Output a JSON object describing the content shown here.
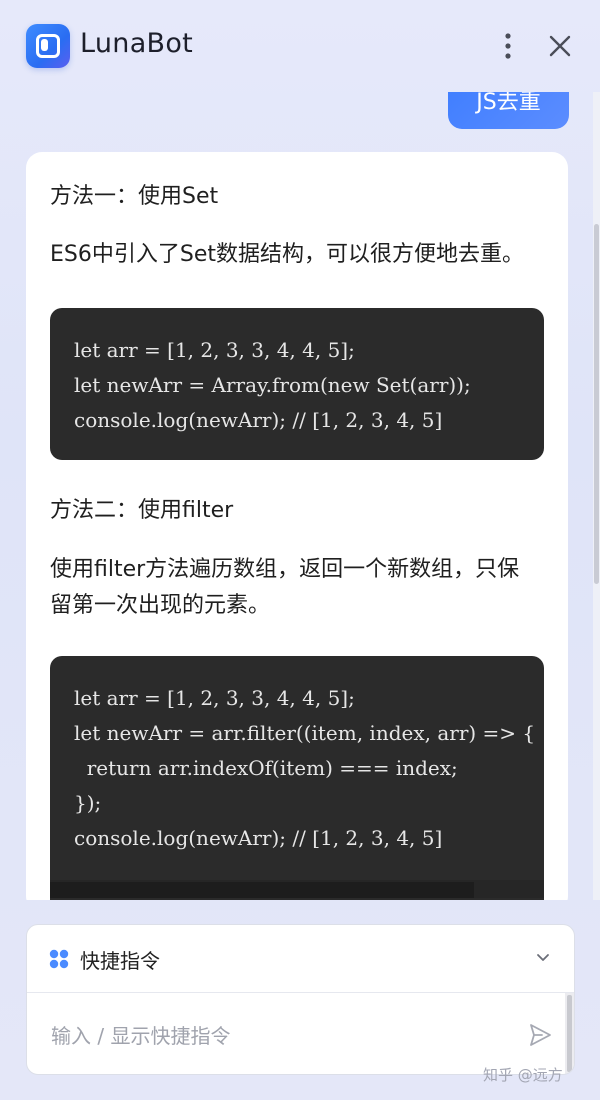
{
  "app": {
    "title": "LunaBot",
    "icons": {
      "logo": "lunabot-logo",
      "more": "more-vertical-icon",
      "close": "close-icon"
    },
    "colors": {
      "accent": "#3d7dff",
      "code_bg": "#2b2b2b"
    }
  },
  "chat": {
    "user_message": "JS去重",
    "bot_reply": {
      "method1_title": "方法一：使用Set",
      "method1_desc": "ES6中引入了Set数据结构，可以很方便地去重。",
      "code1": [
        "let arr = [1, 2, 3, 3, 4, 4, 5];",
        "let newArr = Array.from(new Set(arr));",
        "console.log(newArr); // [1, 2, 3, 4, 5]"
      ],
      "method2_title": "方法二：使用filter",
      "method2_desc_line1": "使用filter方法遍历数组，返回一个新数组，只保",
      "method2_desc_line2": "留第一次出现的元素。",
      "code2": [
        "let arr = [1, 2, 3, 3, 4, 4, 5];",
        "let newArr = arr.filter((item, index, arr) => {",
        "  return arr.indexOf(item) === index;",
        "});",
        "console.log(newArr); // [1, 2, 3, 4, 5]"
      ]
    }
  },
  "composer": {
    "shortcut_label": "快捷指令",
    "input_placeholder": "输入 / 显示快捷指令",
    "input_value": ""
  },
  "watermark": "知乎 @远方"
}
